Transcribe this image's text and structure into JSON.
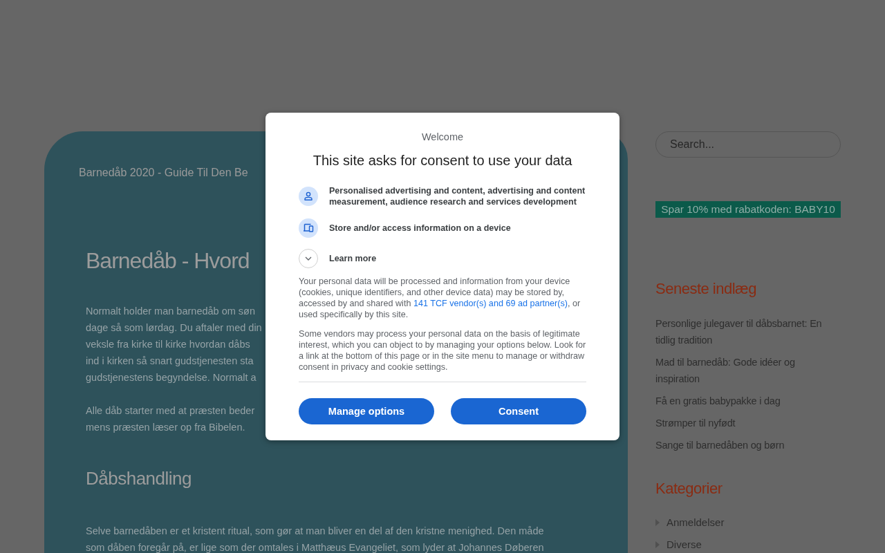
{
  "article": {
    "kicker": "Barnedåb 2020 - Guide Til Den Be",
    "title": "Barnedåb - Hvord",
    "blocks": [
      {
        "kind": "paragraph",
        "lines": [
          "Normalt holder man barnedåb om søn",
          "dage så som lørdag. Du aftaler med din",
          "veksle fra kirke til kirke hvordan dåbs",
          "ind i kirken så snart gudstjenesten sta",
          "gudstjenestens begyndelse. Normalt a"
        ]
      },
      {
        "kind": "paragraph",
        "lines": [
          "Alle dåb starter med at præsten beder",
          "mens præsten læser op fra Bibelen."
        ]
      },
      {
        "kind": "subheading",
        "text": "Dåbshandling"
      },
      {
        "kind": "paragraph",
        "lines": [
          "Selve barnedåben er et kristent ritual, som gør at man bliver en del af den kristne menighed. Den måde",
          "som dåben foregår på, er lige som der omtales i Matthæus Evangeliet, som lyder at Johannes Døberen"
        ]
      }
    ]
  },
  "sidebar": {
    "search": {
      "placeholder": "Search..."
    },
    "promo": "Spar 10% med rabatkoden: BABY10",
    "recent_posts": {
      "title": "Seneste indlæg",
      "items": [
        "Personlige julegaver til dåbsbarnet: En tidlig tradition",
        "Mad til barnedåb: Gode idéer og inspiration",
        "Få en gratis babypakke i dag",
        "Strømper til nyfødt",
        "Sange til barnedåben og børn"
      ]
    },
    "categories": {
      "title": "Kategorier",
      "items": [
        "Anmeldelser",
        "Diverse"
      ]
    }
  },
  "consent_dialog": {
    "welcome": "Welcome",
    "title": "This site asks for consent to use your data",
    "purposes": [
      {
        "kind": "ads",
        "text": "Personalised advertising and content, advertising and content measurement, audience research and services development"
      },
      {
        "kind": "storage",
        "text": "Store and/or access information on a device"
      }
    ],
    "learn_more": {
      "label": "Learn more",
      "expanded": false
    },
    "notice": {
      "before": "Your personal data will be processed and information from your device (cookies, unique identifiers, and other device data) may be stored by, accessed by and shared with ",
      "link": "141 TCF vendor(s) and 69 ad partner(s)",
      "after": ", or used specifically by this site."
    },
    "legitimate_interest": "Some vendors may process your personal data on the basis of legitimate interest, which you can object to by managing your options below. Look for a link at the bottom of this page or in the site menu to manage or withdraw consent in privacy and cookie settings.",
    "buttons": [
      "Manage options",
      "Consent"
    ]
  }
}
